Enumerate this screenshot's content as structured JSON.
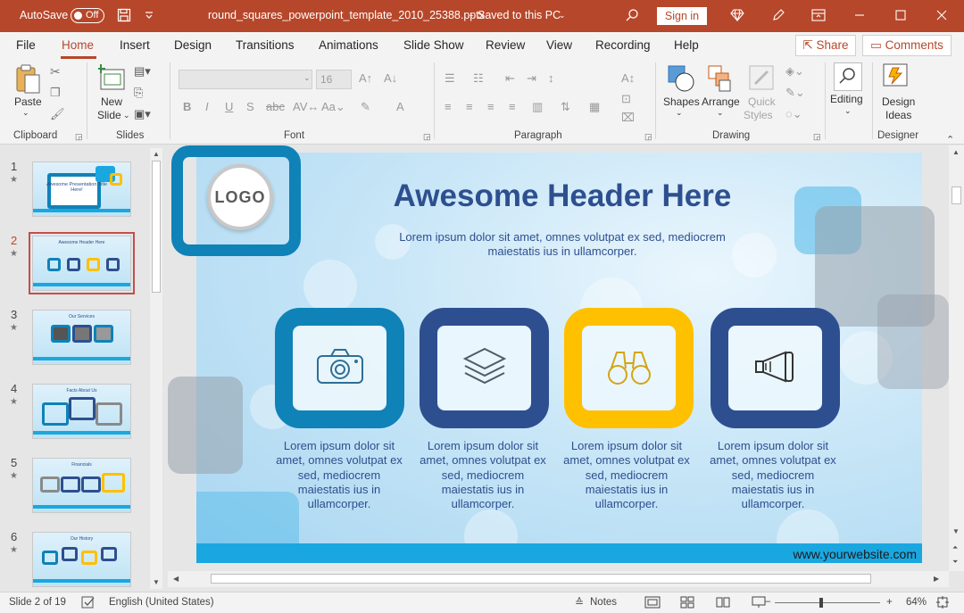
{
  "titlebar": {
    "autosave_label": "AutoSave",
    "autosave_state": "Off",
    "filename": "round_squares_powerpoint_template_2010_25388.pptx",
    "save_status": "Saved to this PC",
    "signin": "Sign in"
  },
  "menu": {
    "tabs": [
      "File",
      "Home",
      "Insert",
      "Design",
      "Transitions",
      "Animations",
      "Slide Show",
      "Review",
      "View",
      "Recording",
      "Help"
    ],
    "active_tab": "Home",
    "share": "Share",
    "comments": "Comments"
  },
  "ribbon": {
    "groups": {
      "clipboard": "Clipboard",
      "slides": "Slides",
      "font": "Font",
      "paragraph": "Paragraph",
      "drawing": "Drawing",
      "designer": "Designer"
    },
    "paste": "Paste",
    "new_slide_1": "New",
    "new_slide_2": "Slide",
    "font_size": "16",
    "shapes": "Shapes",
    "arrange": "Arrange",
    "quick_styles_1": "Quick",
    "quick_styles_2": "Styles",
    "editing": "Editing",
    "design_ideas_1": "Design",
    "design_ideas_2": "Ideas"
  },
  "thumbnails": [
    {
      "num": "1",
      "title": "Awesome Presentation Title Here!"
    },
    {
      "num": "2",
      "title": "Awesome Header Here"
    },
    {
      "num": "3",
      "title": "Our Services"
    },
    {
      "num": "4",
      "title": "Facts About Us"
    },
    {
      "num": "5",
      "title": "Financials"
    },
    {
      "num": "6",
      "title": "Our History"
    }
  ],
  "slide": {
    "logo": "LOGO",
    "header": "Awesome Header Here",
    "subtitle": "Lorem ipsum dolor sit amet, omnes volutpat ex sed, mediocrem maiestatis ius in ullamcorper.",
    "tiles": [
      {
        "icon": "camera-icon",
        "color": "#0f82b8",
        "text": "Lorem ipsum dolor sit amet, omnes volutpat ex sed, mediocrem maiestatis ius in ullamcorper."
      },
      {
        "icon": "layers-icon",
        "color": "#2e4f8f",
        "text": "Lorem ipsum dolor sit amet, omnes volutpat ex sed, mediocrem maiestatis ius in ullamcorper."
      },
      {
        "icon": "binoculars-icon",
        "color": "#ffc000",
        "text": "Lorem ipsum dolor sit amet, omnes volutpat ex sed, mediocrem maiestatis ius in ullamcorper."
      },
      {
        "icon": "megaphone-icon",
        "color": "#2e4f8f",
        "text": "Lorem ipsum dolor sit amet, omnes volutpat ex sed, mediocrem maiestatis ius in ullamcorper."
      }
    ],
    "website": "www.yourwebsite.com"
  },
  "statusbar": {
    "slide_count": "Slide 2 of 19",
    "language": "English (United States)",
    "notes": "Notes",
    "zoom": "64%"
  },
  "colors": {
    "accent": "#b7472a",
    "slide_blue": "#0f82b8",
    "navy": "#2e4f8f",
    "yellow": "#ffc000",
    "bar_blue": "#1aa7e0"
  }
}
